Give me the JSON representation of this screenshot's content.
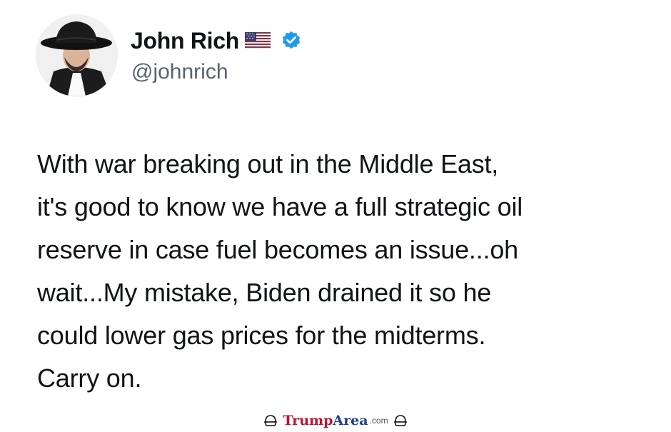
{
  "author": {
    "display_name": "John Rich",
    "handle": "@johnrich",
    "flag_icon": "us-flag-icon",
    "verified_icon": "verified-badge-icon",
    "verified_color": "#1d9bf0"
  },
  "tweet": {
    "text": "With war breaking out in the Middle East,\nit's good to know we have a full strategic oil\nreserve in case fuel becomes an issue...oh\nwait...My mistake, Biden drained it so he\ncould lower gas prices for the midterms.\nCarry on."
  },
  "watermark": {
    "brand_part1": "Trump",
    "brand_part2": "Area",
    "brand_suffix": ".com",
    "brand_color1": "#c8102e",
    "brand_color2": "#1c3f95",
    "icon": "cap-icon"
  }
}
